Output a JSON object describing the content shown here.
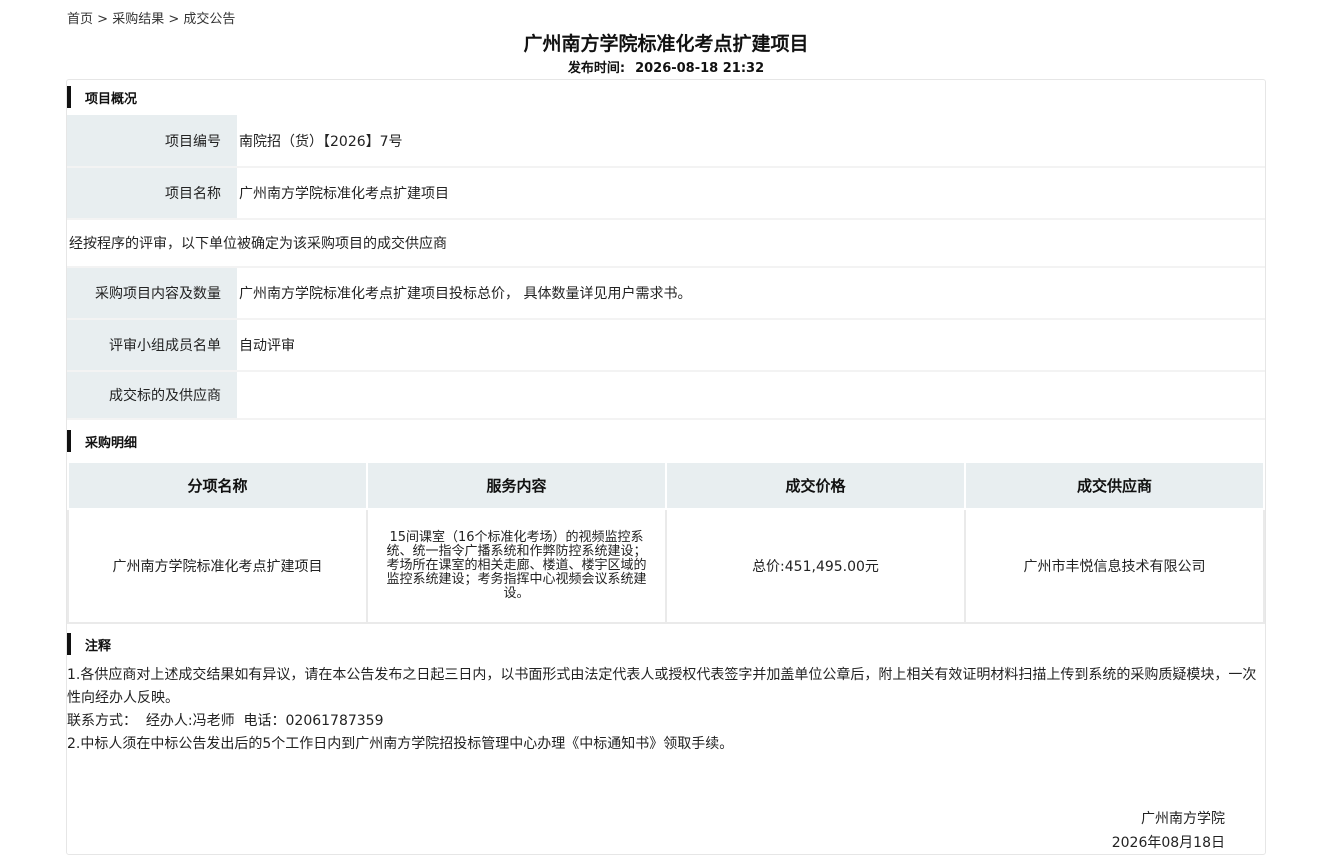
{
  "breadcrumb": {
    "home": "首页",
    "sep1": ">",
    "results": "采购结果",
    "sep2": ">",
    "current": "成交公告"
  },
  "title": "广州南方学院标准化考点扩建项目",
  "publish": {
    "label": "发布时间:",
    "value": "2026-08-18 21:32"
  },
  "overview": {
    "heading": "项目概况",
    "rows": [
      {
        "key": "项目编号",
        "value": "南院招（货）【2026】7号"
      },
      {
        "key": "项目名称",
        "value": "广州南方学院标准化考点扩建项目"
      },
      {
        "full": "经按程序的评审，以下单位被确定为该采购项目的成交供应商"
      },
      {
        "key": "采购项目内容及数量",
        "value": "广州南方学院标准化考点扩建项目投标总价， 具体数量详见用户需求书。"
      },
      {
        "key": "评审小组成员名单",
        "value": "自动评审"
      },
      {
        "key": "成交标的及供应商",
        "value": ""
      }
    ]
  },
  "details": {
    "heading": "采购明细",
    "columns": [
      "分项名称",
      "服务内容",
      "成交价格",
      "成交供应商"
    ],
    "rows": [
      {
        "name": "广州南方学院标准化考点扩建项目",
        "service": "15间课室（16个标准化考场）的视频监控系统、统一指令广播系统和作弊防控系统建设；考场所在课室的相关走廊、楼道、楼宇区域的监控系统建设；考务指挥中心视频会议系统建设。",
        "price": "总价:451,495.00元",
        "supplier": "广州市丰悦信息技术有限公司"
      }
    ]
  },
  "notes": {
    "heading": "注释",
    "line1": "1.各供应商对上述成交结果如有异议，请在本公告发布之日起三日内，以书面形式由法定代表人或授权代表签字并加盖单位公章后，附上相关有效证明材料扫描上传到系统的采购质疑模块，一次性向经办人反映。",
    "contact": "联系方式：  经办人:冯老师  电话：02061787359",
    "line2": "2.中标人须在中标公告发出后的5个工作日内到广州南方学院招投标管理中心办理《中标通知书》领取手续。"
  },
  "signature": {
    "org": "广州南方学院",
    "date": "2026年08月18日"
  }
}
